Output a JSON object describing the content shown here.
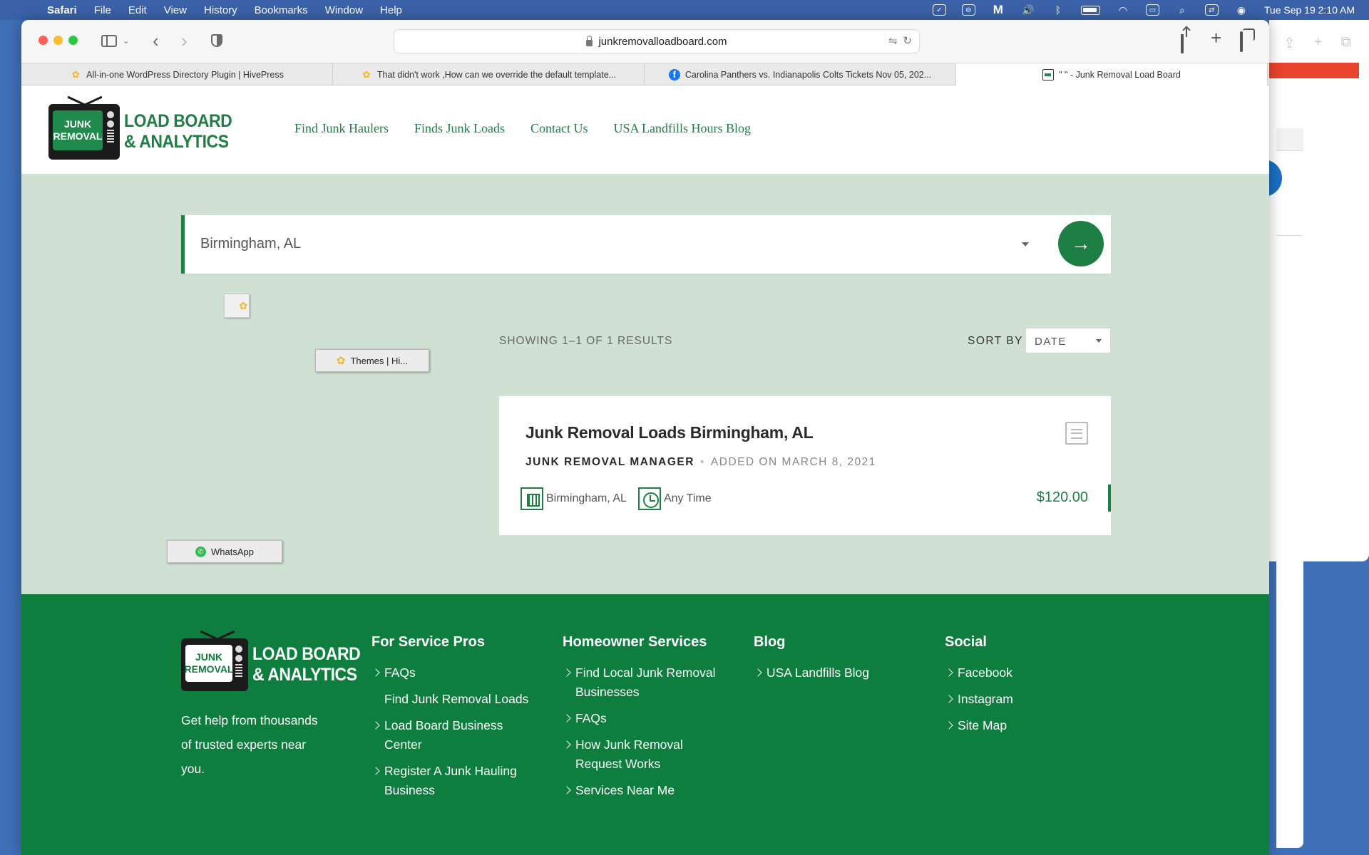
{
  "menubar": {
    "app": "Safari",
    "items": [
      "File",
      "Edit",
      "View",
      "History",
      "Bookmarks",
      "Window",
      "Help"
    ],
    "datetime": "Tue Sep 19  2:10 AM"
  },
  "browser": {
    "url": "junkremovalloadboard.com",
    "tabs": [
      {
        "title": "All-in-one WordPress Directory Plugin | HivePress",
        "icon": "hivepress-icon"
      },
      {
        "title": "That didn't work ,How can we override the default template...",
        "icon": "hivepress-icon"
      },
      {
        "title": "Carolina Panthers vs. Indianapolis Colts Tickets Nov 05, 202...",
        "icon": "facebook-icon"
      },
      {
        "title": "\" \" - Junk Removal Load Board",
        "icon": "page-icon"
      }
    ]
  },
  "site": {
    "logo": {
      "screen_line1": "JUNK",
      "screen_line2": "REMOVAL",
      "text_line1": "LOAD BOARD",
      "text_line2": "& ANALYTICS"
    },
    "nav": [
      "Find Junk Haulers",
      "Finds Junk Loads",
      "Contact Us",
      "USA Landfills Hours Blog"
    ],
    "search": {
      "value": "Birmingham, AL"
    },
    "overlays": {
      "themes_chip": "Themes | Hi...",
      "whatsapp_chip": "WhatsApp"
    },
    "results": {
      "summary": "SHOWING 1–1 OF 1 RESULTS",
      "sort_label": "SORT BY",
      "sort_value": "DATE"
    },
    "listing": {
      "title": "Junk Removal Loads Birmingham, AL",
      "author": "JUNK REMOVAL MANAGER",
      "added": "ADDED ON MARCH 8, 2021",
      "location": "Birmingham, AL",
      "time": "Any Time",
      "price": "$120.00"
    },
    "footer": {
      "tagline": "Get help from thousands of trusted experts near you.",
      "columns": [
        {
          "title": "For Service Pros",
          "links": [
            {
              "label": "FAQs",
              "chevron": true
            },
            {
              "label": "Find Junk Removal Loads",
              "chevron": false
            },
            {
              "label": "Load Board Business Center",
              "chevron": true
            },
            {
              "label": "Register A Junk Hauling Business",
              "chevron": true
            }
          ]
        },
        {
          "title": "Homeowner Services",
          "links": [
            {
              "label": "Find Local Junk Removal Businesses",
              "chevron": true
            },
            {
              "label": "FAQs",
              "chevron": true
            },
            {
              "label": "How Junk Removal Request Works",
              "chevron": true
            },
            {
              "label": "Services Near Me",
              "chevron": true
            }
          ]
        },
        {
          "title": "Blog",
          "links": [
            {
              "label": "USA Landfills Blog",
              "chevron": true
            }
          ]
        },
        {
          "title": "Social",
          "links": [
            {
              "label": "Facebook",
              "chevron": true
            },
            {
              "label": "Instagram",
              "chevron": true
            },
            {
              "label": "Site Map",
              "chevron": true
            }
          ]
        }
      ]
    }
  },
  "colors": {
    "brand_green": "#1e7f45",
    "footer_green": "#0e7e3e",
    "hero_bg": "#d0e0d2"
  }
}
